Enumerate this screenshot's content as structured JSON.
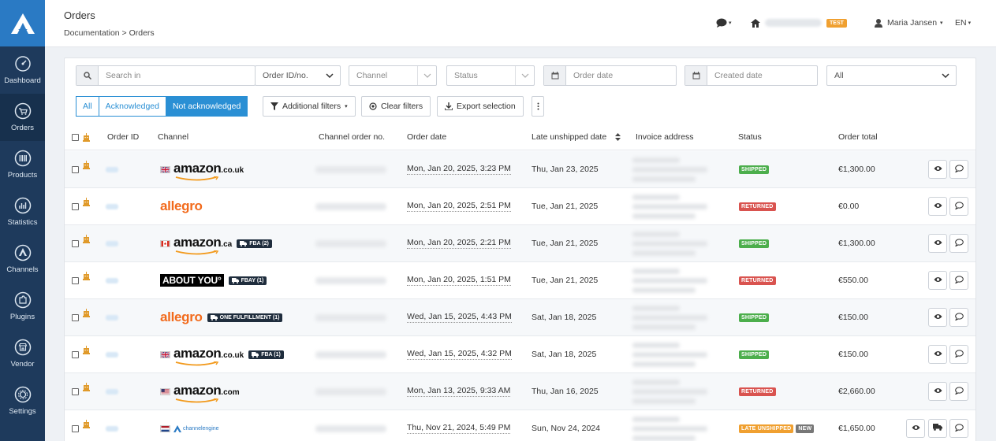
{
  "sidebar": {
    "items": [
      {
        "label": "Dashboard",
        "icon": "gauge-icon"
      },
      {
        "label": "Orders",
        "icon": "cart-icon"
      },
      {
        "label": "Products",
        "icon": "barcode-icon"
      },
      {
        "label": "Statistics",
        "icon": "chart-icon"
      },
      {
        "label": "Channels",
        "icon": "channels-icon"
      },
      {
        "label": "Plugins",
        "icon": "puzzle-icon"
      },
      {
        "label": "Vendor",
        "icon": "store-icon"
      },
      {
        "label": "Settings",
        "icon": "gear-icon"
      }
    ],
    "active": "Orders"
  },
  "header": {
    "title": "Orders",
    "breadcrumb": "Documentation > Orders",
    "test_badge": "TEST",
    "user_name": "Maria Jansen",
    "language": "EN"
  },
  "filters": {
    "search_placeholder": "Search in",
    "search_field": "Order ID/no.",
    "channel_placeholder": "Channel",
    "status_placeholder": "Status",
    "order_date_placeholder": "Order date",
    "created_date_placeholder": "Created date",
    "all_select": "All",
    "seg_all": "All",
    "seg_ack": "Acknowledged",
    "seg_not_ack": "Not acknowledged",
    "additional_filters": "Additional filters",
    "clear_filters": "Clear filters",
    "export_selection": "Export selection"
  },
  "table": {
    "headers": {
      "order_id": "Order ID",
      "channel": "Channel",
      "channel_order_no": "Channel order no.",
      "order_date": "Order date",
      "late_unshipped": "Late unshipped date",
      "invoice_address": "Invoice address",
      "status": "Status",
      "order_total": "Order total"
    },
    "rows": [
      {
        "channel": "amazon",
        "tld": ".co.uk",
        "flag": "uk",
        "fulfillment": "",
        "order_date": "Mon, Jan 20, 2025, 3:23 PM",
        "late_date": "Thu, Jan 23, 2025",
        "status": "SHIPPED",
        "status_type": "shipped",
        "new": "",
        "total": "€1,300.00"
      },
      {
        "channel": "allegro",
        "tld": "",
        "flag": "",
        "fulfillment": "",
        "order_date": "Mon, Jan 20, 2025, 2:51 PM",
        "late_date": "Tue, Jan 21, 2025",
        "status": "RETURNED",
        "status_type": "returned",
        "new": "",
        "total": "€0.00"
      },
      {
        "channel": "amazon",
        "tld": ".ca",
        "flag": "ca",
        "fulfillment": "FBA (2)",
        "order_date": "Mon, Jan 20, 2025, 2:21 PM",
        "late_date": "Tue, Jan 21, 2025",
        "status": "SHIPPED",
        "status_type": "shipped",
        "new": "",
        "total": "€1,300.00"
      },
      {
        "channel": "aboutyou",
        "tld": "",
        "flag": "",
        "fulfillment": "FBAY (1)",
        "order_date": "Mon, Jan 20, 2025, 1:51 PM",
        "late_date": "Tue, Jan 21, 2025",
        "status": "RETURNED",
        "status_type": "returned",
        "new": "",
        "total": "€550.00"
      },
      {
        "channel": "allegro",
        "tld": "",
        "flag": "",
        "fulfillment": "ONE FULFILLMENT (1)",
        "order_date": "Wed, Jan 15, 2025, 4:43 PM",
        "late_date": "Sat, Jan 18, 2025",
        "status": "SHIPPED",
        "status_type": "shipped",
        "new": "",
        "total": "€150.00"
      },
      {
        "channel": "amazon",
        "tld": ".co.uk",
        "flag": "uk",
        "fulfillment": "FBA (1)",
        "order_date": "Wed, Jan 15, 2025, 4:32 PM",
        "late_date": "Sat, Jan 18, 2025",
        "status": "SHIPPED",
        "status_type": "shipped",
        "new": "",
        "total": "€150.00"
      },
      {
        "channel": "amazon",
        "tld": ".com",
        "flag": "us",
        "fulfillment": "",
        "order_date": "Mon, Jan 13, 2025, 9:33 AM",
        "late_date": "Thu, Jan 16, 2025",
        "status": "RETURNED",
        "status_type": "returned",
        "new": "",
        "total": "€2,660.00"
      },
      {
        "channel": "channelengine",
        "tld": "",
        "flag": "nl",
        "fulfillment": "",
        "order_date": "Thu, Nov 21, 2024, 5:49 PM",
        "late_date": "Sun, Nov 24, 2024",
        "status": "LATE UNSHIPPED",
        "status_type": "late",
        "new": "NEW",
        "total": "€1,650.00"
      }
    ]
  },
  "colors": {
    "sidebar": "#1e3a5c",
    "accent": "#2a8fd4",
    "shipped": "#4cae4c",
    "returned": "#d9534f",
    "late": "#f0a030"
  }
}
